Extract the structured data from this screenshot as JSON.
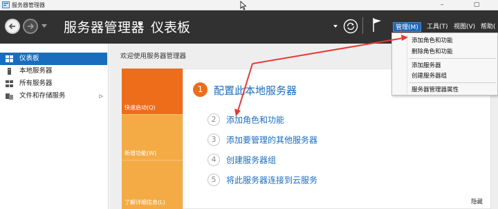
{
  "titlebar": {
    "title": "服务器管理器",
    "buttons": [
      "–",
      "▢"
    ]
  },
  "header": {
    "page_title": "服务器管理器",
    "breadcrumb_sep": "▸",
    "sub_title": "仪表板",
    "menu": [
      {
        "label": "管理(M)",
        "active": true
      },
      {
        "label": "工具(T)",
        "active": false
      },
      {
        "label": "视图(V)",
        "active": false
      },
      {
        "label": "帮助(",
        "active": false
      }
    ]
  },
  "sidebar": {
    "items": [
      {
        "label": "仪表板",
        "selected": true,
        "icon": "dashboard-icon"
      },
      {
        "label": "本地服务器",
        "selected": false,
        "icon": "server-icon"
      },
      {
        "label": "所有服务器",
        "selected": false,
        "icon": "servers-icon"
      },
      {
        "label": "文件和存储服务",
        "selected": false,
        "icon": "storage-icon",
        "arrow": "▷"
      }
    ]
  },
  "main": {
    "welcome": "欢迎使用服务器管理器",
    "tiles": [
      {
        "label": "快速启动(Q)",
        "color": "#ee6d1a"
      },
      {
        "label": "新增功能(W)",
        "color": "#f4ab45"
      },
      {
        "label": "了解详细信息(L)",
        "color": "#f4ab45"
      }
    ],
    "primary_step": {
      "num": "1",
      "label": "配置此本地服务器"
    },
    "steps": [
      {
        "num": "2",
        "label": "添加角色和功能"
      },
      {
        "num": "3",
        "label": "添加要管理的其他服务器"
      },
      {
        "num": "4",
        "label": "创建服务器组"
      },
      {
        "num": "5",
        "label": "将此服务器连接到云服务"
      }
    ],
    "hide": "隐藏"
  },
  "dropdown": {
    "group1": [
      "添加角色和功能",
      "删除角色和功能"
    ],
    "group2": [
      "添加服务器",
      "创建服务器组"
    ],
    "group3": [
      "服务器管理器属性"
    ]
  },
  "colors": {
    "accent_blue": "#1a6dbd",
    "orange": "#ee6d1a",
    "light_orange": "#f4ab45",
    "arrow_red": "#e53935"
  }
}
